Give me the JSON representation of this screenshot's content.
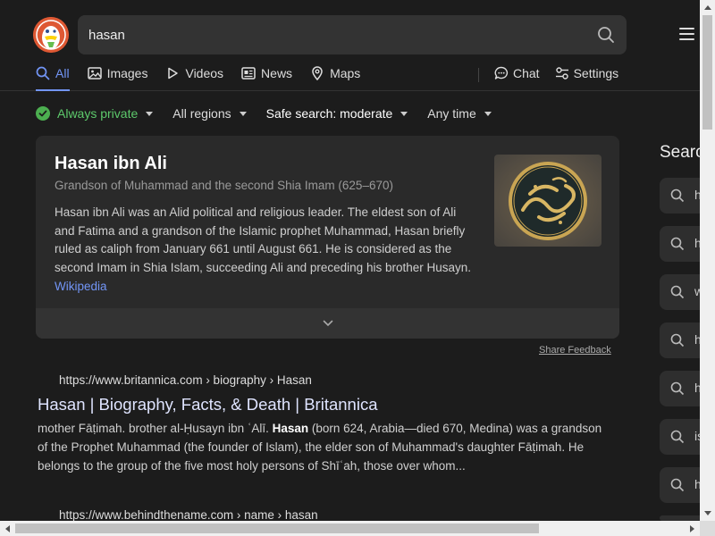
{
  "search": {
    "query": "hasan"
  },
  "tabs": [
    {
      "label": "All",
      "icon": "search-icon",
      "active": true
    },
    {
      "label": "Images",
      "icon": "image-icon"
    },
    {
      "label": "Videos",
      "icon": "play-icon"
    },
    {
      "label": "News",
      "icon": "newspaper-icon"
    },
    {
      "label": "Maps",
      "icon": "map-pin-icon"
    }
  ],
  "right_tabs": [
    {
      "label": "Chat",
      "icon": "chat-icon"
    },
    {
      "label": "Settings",
      "icon": "settings-icon"
    }
  ],
  "filters": {
    "privacy": "Always private",
    "region": "All regions",
    "safe_search": "Safe search: moderate",
    "time": "Any time"
  },
  "knowledge_card": {
    "title": "Hasan ibn Ali",
    "subtitle": "Grandson of Muhammad and the second Shia Imam (625–670)",
    "body": "Hasan ibn Ali was an Alid political and religious leader. The eldest son of Ali and Fatima and a grandson of the Islamic prophet Muhammad, Hasan briefly ruled as caliph from January 661 until August 661. He is considered as the second Imam in Shia Islam, succeeding Ali and preceding his brother Husayn.",
    "source_link": "Wikipedia",
    "image_alt": "calligraphy-medallion"
  },
  "share_feedback": "Share Feedback",
  "results": [
    {
      "url": "https://www.britannica.com › biography › Hasan",
      "title": "Hasan | Biography, Facts, & Death | Britannica",
      "snippet_pre": "mother Fāṭimah. brother al-Ḥusayn ibn ʿAlī. ",
      "snippet_bold": "Hasan",
      "snippet_post": " (born 624, Arabia—died 670, Medina) was a grandson of the Prophet Muhammad (the founder of Islam), the elder son of Muhammad's daughter Fāṭimah. He belongs to the group of the five most holy persons of Shīʿah, those over whom..."
    },
    {
      "url": "https://www.behindthename.com › name › hasan"
    }
  ],
  "sidebar": {
    "title": "Searc",
    "items": [
      "h",
      "h",
      "w",
      "h",
      "h",
      "is",
      "h",
      ""
    ]
  },
  "colors": {
    "accent": "#7295f6",
    "private_green": "#5dc96b",
    "background": "#1c1c1c",
    "card": "#2a2a2a"
  }
}
